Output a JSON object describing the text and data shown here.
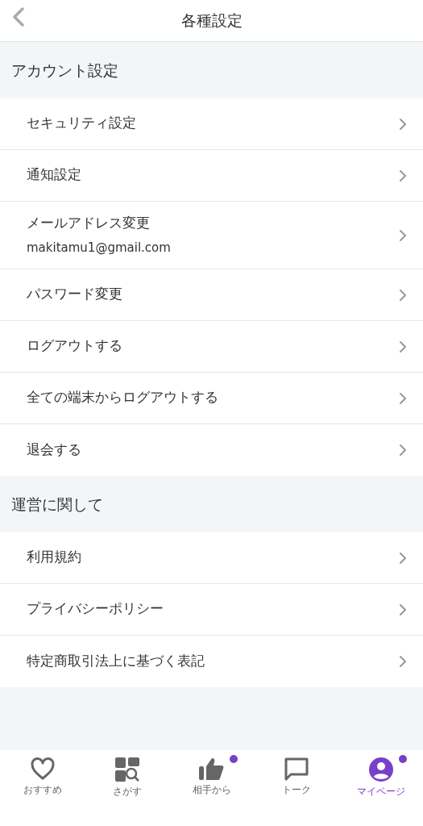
{
  "header": {
    "title": "各種設定"
  },
  "sections": [
    {
      "title": "アカウント設定",
      "items": [
        {
          "label": "セキュリティ設定"
        },
        {
          "label": "通知設定"
        },
        {
          "label": "メールアドレス変更",
          "sub": "makitamu1@gmail.com"
        },
        {
          "label": "パスワード変更"
        },
        {
          "label": "ログアウトする"
        },
        {
          "label": "全ての端末からログアウトする"
        },
        {
          "label": "退会する"
        }
      ]
    },
    {
      "title": "運営に関して",
      "items": [
        {
          "label": "利用規約"
        },
        {
          "label": "プライバシーポリシー"
        },
        {
          "label": "特定商取引法上に基づく表記"
        }
      ]
    }
  ],
  "tabbar": [
    {
      "kind": "heart",
      "label": "おすすめ",
      "selected": false,
      "badge": false
    },
    {
      "kind": "search",
      "label": "さがす",
      "selected": false,
      "badge": false
    },
    {
      "kind": "thumb",
      "label": "相手から",
      "selected": false,
      "badge": true
    },
    {
      "kind": "chat",
      "label": "トーク",
      "selected": false,
      "badge": false
    },
    {
      "kind": "person",
      "label": "マイページ",
      "selected": true,
      "badge": true
    }
  ]
}
